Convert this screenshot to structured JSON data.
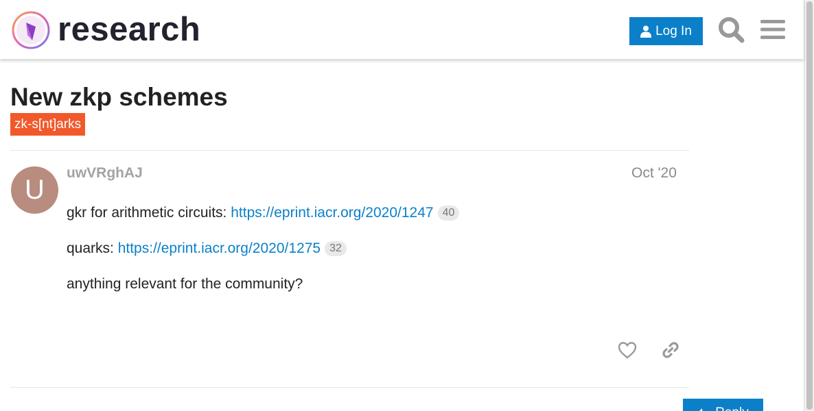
{
  "header": {
    "site_title": "research",
    "login_label": "Log In"
  },
  "topic": {
    "title": "New zkp schemes",
    "category": "zk-s[nt]arks",
    "category_color": "#f1592a"
  },
  "post": {
    "avatar_letter": "U",
    "avatar_color": "#b88c7e",
    "username": "uwVRghAJ",
    "date": "Oct '20",
    "lines": [
      {
        "prefix": "gkr for arithmetic circuits: ",
        "link": "https://eprint.iacr.org/2020/1247",
        "clicks": "40"
      },
      {
        "prefix": "quarks: ",
        "link": "https://eprint.iacr.org/2020/1275",
        "clicks": "32"
      },
      {
        "text": "anything relevant for the community?"
      }
    ]
  },
  "footer": {
    "reply_label": "Reply"
  },
  "colors": {
    "accent": "#0b80c9",
    "link": "#0b80c9"
  }
}
